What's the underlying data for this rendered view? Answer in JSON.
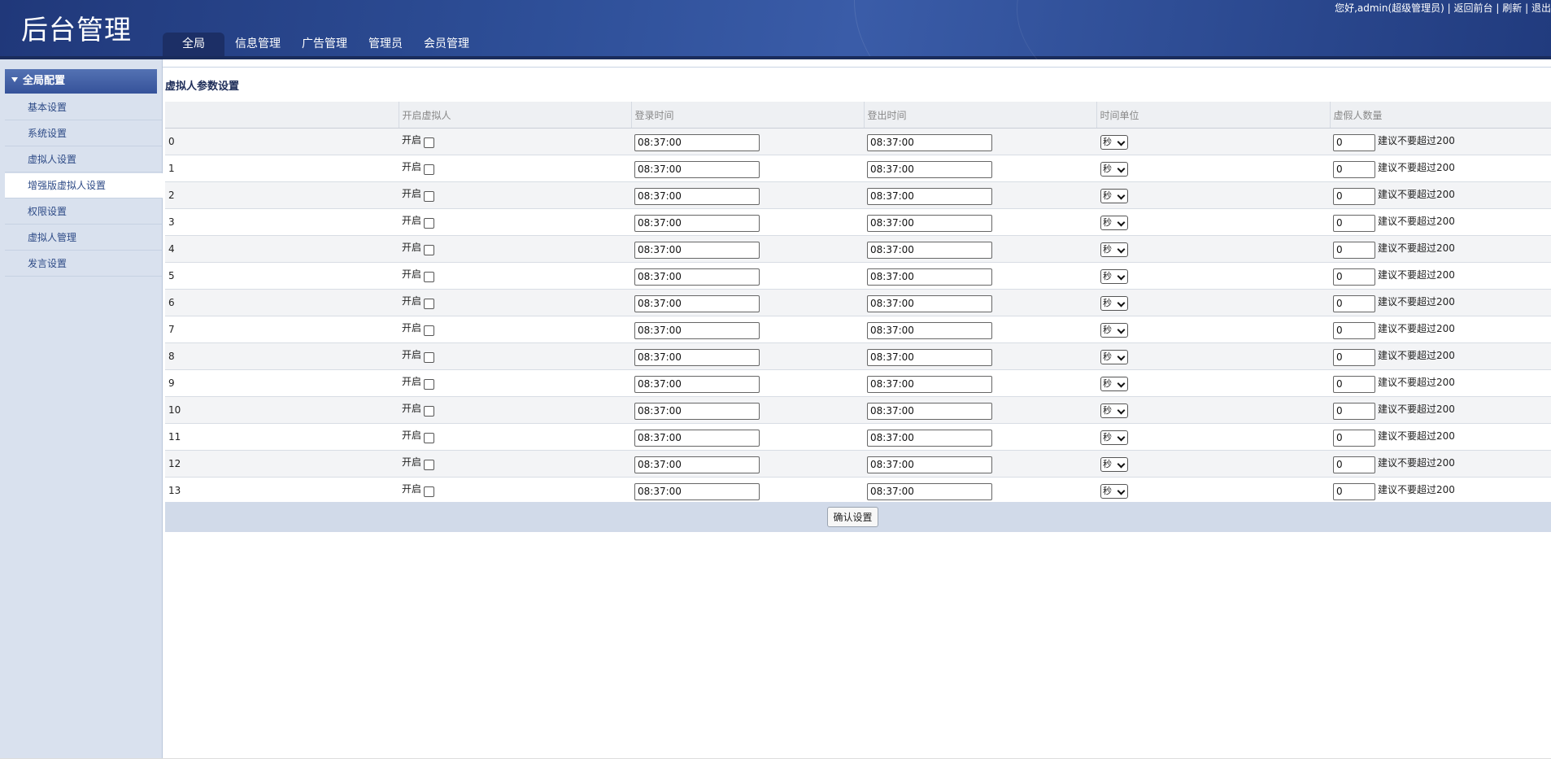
{
  "header": {
    "logo": "后台管理",
    "tabs": [
      "全局",
      "信息管理",
      "广告管理",
      "管理员",
      "会员管理"
    ],
    "user": {
      "greeting": "您好,admin(超级管理员)",
      "sep": "|",
      "back": "返回前台",
      "refresh": "刷新",
      "logout": "退出"
    }
  },
  "sidebar": {
    "title": "全局配置",
    "items": [
      "基本设置",
      "系统设置",
      "虚拟人设置",
      "增强版虚拟人设置",
      "权限设置",
      "虚拟人管理",
      "发言设置"
    ],
    "active_index": 3
  },
  "main": {
    "title": "虚拟人参数设置",
    "columns": [
      "",
      "开启虚拟人",
      "登录时间",
      "登出时间",
      "时间单位",
      "虚假人数量"
    ],
    "rows": [
      {
        "id": "0",
        "open_label": "开启",
        "login": "08:37:00",
        "logout": "08:37:00",
        "unit": "秒",
        "count": "0",
        "hint": "建议不要超过200"
      },
      {
        "id": "1",
        "open_label": "开启",
        "login": "08:37:00",
        "logout": "08:37:00",
        "unit": "秒",
        "count": "0",
        "hint": "建议不要超过200"
      },
      {
        "id": "2",
        "open_label": "开启",
        "login": "08:37:00",
        "logout": "08:37:00",
        "unit": "秒",
        "count": "0",
        "hint": "建议不要超过200"
      },
      {
        "id": "3",
        "open_label": "开启",
        "login": "08:37:00",
        "logout": "08:37:00",
        "unit": "秒",
        "count": "0",
        "hint": "建议不要超过200"
      },
      {
        "id": "4",
        "open_label": "开启",
        "login": "08:37:00",
        "logout": "08:37:00",
        "unit": "秒",
        "count": "0",
        "hint": "建议不要超过200"
      },
      {
        "id": "5",
        "open_label": "开启",
        "login": "08:37:00",
        "logout": "08:37:00",
        "unit": "秒",
        "count": "0",
        "hint": "建议不要超过200"
      },
      {
        "id": "6",
        "open_label": "开启",
        "login": "08:37:00",
        "logout": "08:37:00",
        "unit": "秒",
        "count": "0",
        "hint": "建议不要超过200"
      },
      {
        "id": "7",
        "open_label": "开启",
        "login": "08:37:00",
        "logout": "08:37:00",
        "unit": "秒",
        "count": "0",
        "hint": "建议不要超过200"
      },
      {
        "id": "8",
        "open_label": "开启",
        "login": "08:37:00",
        "logout": "08:37:00",
        "unit": "秒",
        "count": "0",
        "hint": "建议不要超过200"
      },
      {
        "id": "9",
        "open_label": "开启",
        "login": "08:37:00",
        "logout": "08:37:00",
        "unit": "秒",
        "count": "0",
        "hint": "建议不要超过200"
      },
      {
        "id": "10",
        "open_label": "开启",
        "login": "08:37:00",
        "logout": "08:37:00",
        "unit": "秒",
        "count": "0",
        "hint": "建议不要超过200"
      },
      {
        "id": "11",
        "open_label": "开启",
        "login": "08:37:00",
        "logout": "08:37:00",
        "unit": "秒",
        "count": "0",
        "hint": "建议不要超过200"
      },
      {
        "id": "12",
        "open_label": "开启",
        "login": "08:37:00",
        "logout": "08:37:00",
        "unit": "秒",
        "count": "0",
        "hint": "建议不要超过200"
      },
      {
        "id": "13",
        "open_label": "开启",
        "login": "08:37:00",
        "logout": "08:37:00",
        "unit": "秒",
        "count": "0",
        "hint": "建议不要超过200"
      }
    ],
    "submit_label": "确认设置"
  }
}
